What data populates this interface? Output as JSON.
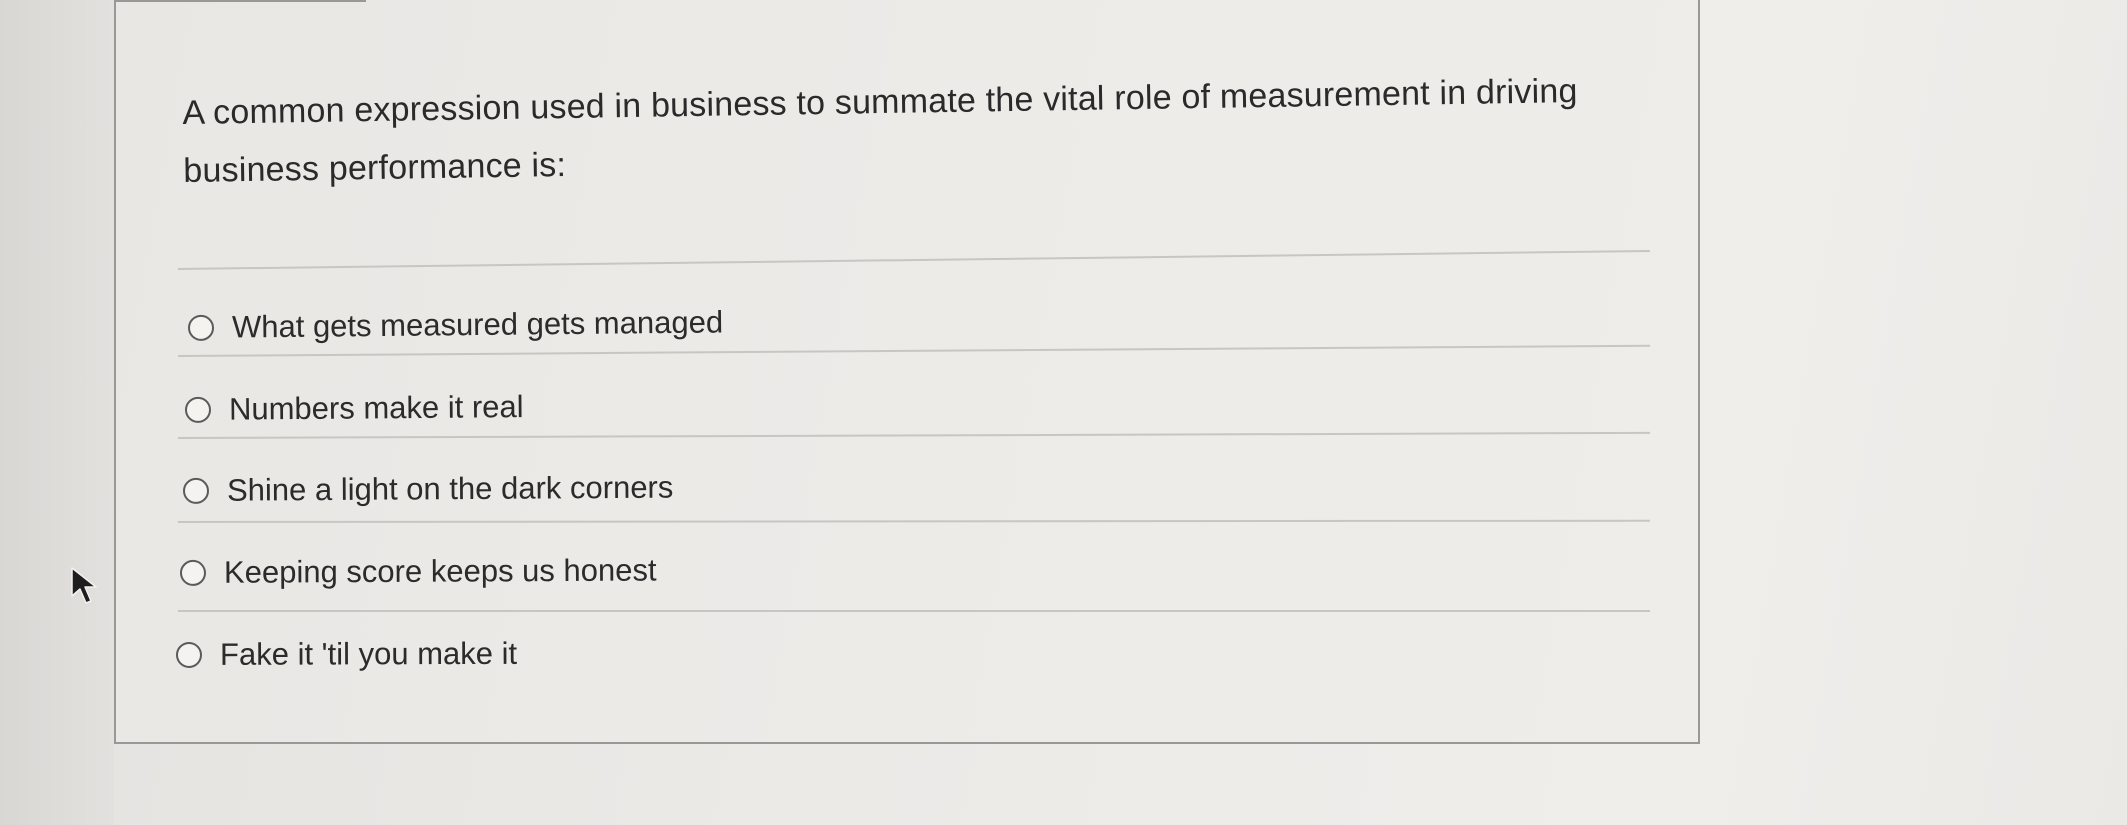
{
  "question": {
    "text": "A common expression used in business to summate the vital role of measurement in driving business performance is:"
  },
  "options": [
    {
      "label": "What gets measured gets managed",
      "selected": false
    },
    {
      "label": "Numbers make it real",
      "selected": false
    },
    {
      "label": "Shine a light on the dark corners",
      "selected": false
    },
    {
      "label": "Keeping score keeps us honest",
      "selected": false
    },
    {
      "label": "Fake it 'til you make it",
      "selected": false
    }
  ],
  "icons": {
    "radio": "radio-button-icon",
    "cursor": "mouse-pointer-icon"
  },
  "colors": {
    "card_border": "#9a9896",
    "text": "#2a2a2a",
    "divider": "#c8c6c2"
  }
}
